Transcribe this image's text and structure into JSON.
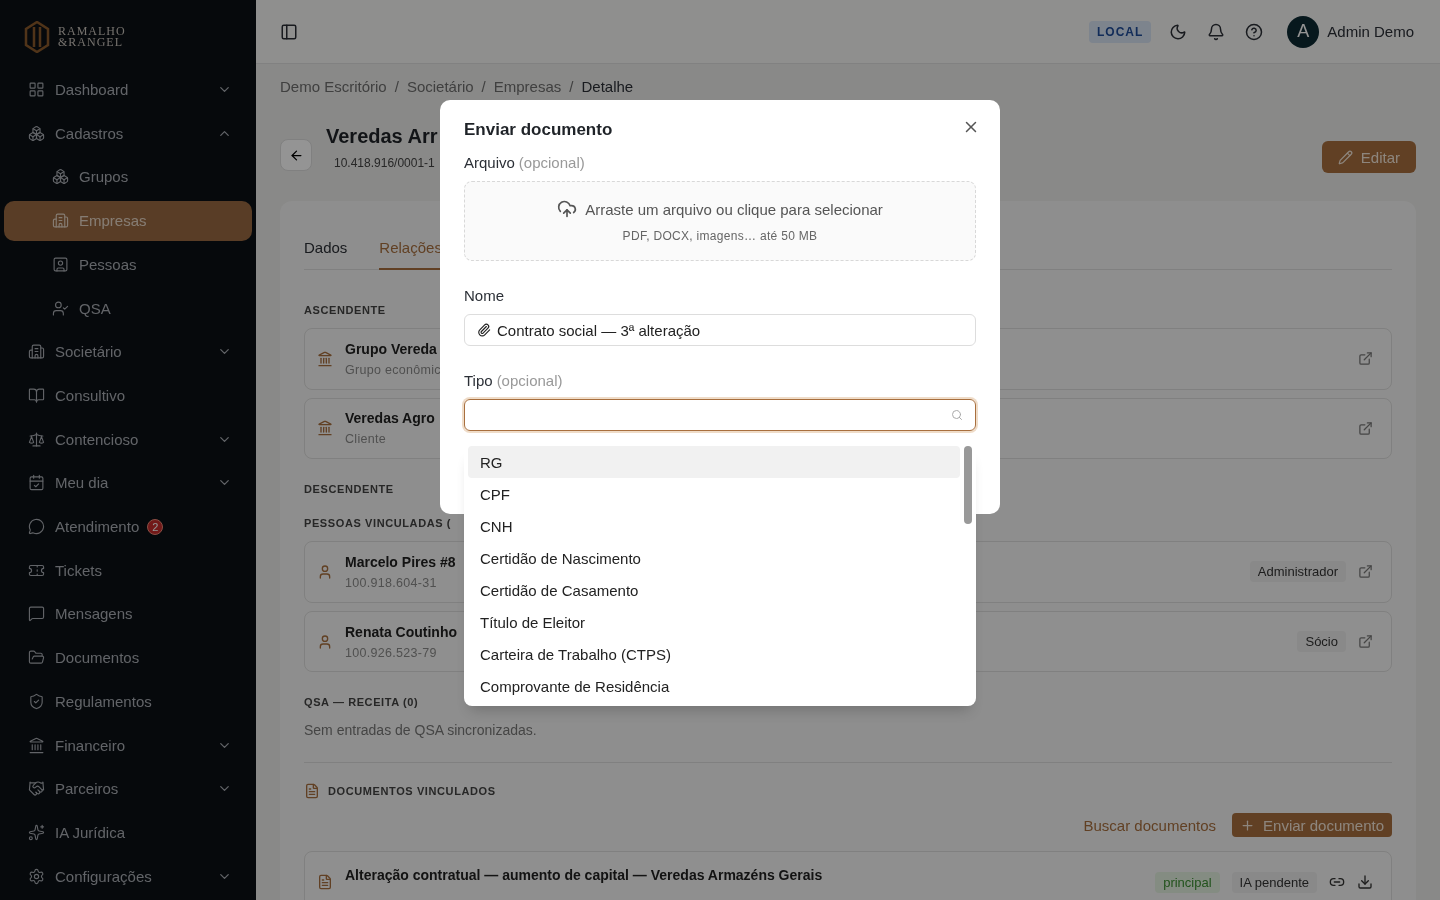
{
  "sidebar": {
    "logo": {
      "line1": "RAMALHO",
      "line2": "&RANGEL"
    },
    "items": [
      {
        "label": "Dashboard",
        "expandable": true,
        "expanded": false,
        "selected": false
      },
      {
        "label": "Cadastros",
        "expandable": true,
        "expanded": true,
        "selected": false,
        "children": [
          {
            "label": "Grupos",
            "selected": false
          },
          {
            "label": "Empresas",
            "selected": true
          },
          {
            "label": "Pessoas",
            "selected": false
          },
          {
            "label": "QSA",
            "selected": false
          }
        ]
      },
      {
        "label": "Societário",
        "expandable": true,
        "expanded": false,
        "selected": false
      },
      {
        "label": "Consultivo",
        "expandable": false,
        "selected": false
      },
      {
        "label": "Contencioso",
        "expandable": true,
        "expanded": false,
        "selected": false
      },
      {
        "label": "Meu dia",
        "expandable": true,
        "expanded": false,
        "selected": false
      },
      {
        "label": "Atendimento",
        "expandable": false,
        "selected": false,
        "badge": "2"
      },
      {
        "label": "Tickets",
        "expandable": false,
        "selected": false
      },
      {
        "label": "Mensagens",
        "expandable": false,
        "selected": false
      },
      {
        "label": "Documentos",
        "expandable": false,
        "selected": false
      },
      {
        "label": "Regulamentos",
        "expandable": false,
        "selected": false
      },
      {
        "label": "Financeiro",
        "expandable": true,
        "expanded": false,
        "selected": false
      },
      {
        "label": "Parceiros",
        "expandable": true,
        "expanded": false,
        "selected": false
      },
      {
        "label": "IA Jurídica",
        "expandable": false,
        "selected": false
      },
      {
        "label": "Configurações",
        "expandable": true,
        "expanded": false,
        "selected": false
      }
    ]
  },
  "header": {
    "environment": "LOCAL",
    "user": {
      "initial": "A",
      "name": "Admin Demo"
    }
  },
  "breadcrumb": [
    {
      "kind": "link",
      "text": "Demo Escritório"
    },
    {
      "kind": "separator",
      "text": "/"
    },
    {
      "kind": "link",
      "text": "Societário"
    },
    {
      "kind": "separator",
      "text": "/"
    },
    {
      "kind": "link",
      "text": "Empresas"
    },
    {
      "kind": "separator",
      "text": "/"
    },
    {
      "kind": "current",
      "text": "Detalhe"
    }
  ],
  "page": {
    "title": "Veredas Arr",
    "subtitle": "10.418.916/0001-1",
    "edit_button": "Editar"
  },
  "tabs": [
    {
      "label": "Dados",
      "selected": false
    },
    {
      "label": "Relações",
      "selected": true
    }
  ],
  "ascendente": {
    "heading": "ASCENDENTE",
    "items": [
      {
        "name": "Grupo Vereda",
        "detail": "Grupo econômic"
      },
      {
        "name": "Veredas Agro",
        "detail": "Cliente"
      }
    ]
  },
  "descendente": {
    "heading": "DESCENDENTE"
  },
  "pessoas": {
    "heading": "PESSOAS VINCULADAS (",
    "items": [
      {
        "name": "Marcelo Pires #8",
        "detail": "100.918.604-31",
        "role": "Administrador"
      },
      {
        "name": "Renata Coutinho",
        "detail": "100.926.523-79",
        "role": "Sócio"
      }
    ]
  },
  "qsa": {
    "heading": "QSA — RECEITA (0)",
    "empty_text": "Sem entradas de QSA sincronizadas."
  },
  "documentos": {
    "heading": "DOCUMENTOS VINCULADOS",
    "search_link": "Buscar documentos",
    "upload_button": "Enviar documento",
    "items": [
      {
        "title": "Alteração contratual — aumento de capital — Veredas Armazéns Gerais",
        "tags": [
          {
            "label": "principal",
            "kind": "success"
          },
          {
            "label": "IA pendente",
            "kind": "neutral"
          }
        ]
      }
    ]
  },
  "modal": {
    "title": "Enviar documento",
    "file_field": {
      "label": "Arquivo",
      "hint": "(opcional)",
      "drop_text": "Arraste um arquivo ou clique para selecionar",
      "drop_note": "PDF, DOCX, imagens… até 50 MB"
    },
    "name_field": {
      "label": "Nome",
      "value": "Contrato social — 3ª alteração"
    },
    "type_field": {
      "label": "Tipo",
      "hint": "(opcional)",
      "focused": true,
      "options": [
        {
          "label": "RG",
          "highlighted": true
        },
        {
          "label": "CPF",
          "highlighted": false
        },
        {
          "label": "CNH",
          "highlighted": false
        },
        {
          "label": "Certidão de Nascimento",
          "highlighted": false
        },
        {
          "label": "Certidão de Casamento",
          "highlighted": false
        },
        {
          "label": "Título de Eleitor",
          "highlighted": false
        },
        {
          "label": "Carteira de Trabalho (CTPS)",
          "highlighted": false
        },
        {
          "label": "Comprovante de Residência",
          "highlighted": false
        }
      ]
    }
  }
}
